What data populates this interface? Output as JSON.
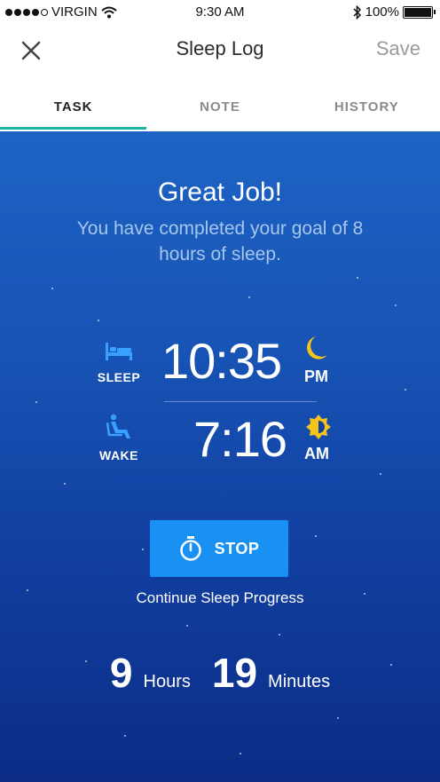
{
  "status_bar": {
    "carrier": "VIRGIN",
    "time": "9:30 AM",
    "battery": "100%"
  },
  "header": {
    "title": "Sleep Log",
    "save_label": "Save",
    "close_icon": "close-icon"
  },
  "tabs": [
    {
      "label": "TASK",
      "active": true
    },
    {
      "label": "NOTE",
      "active": false
    },
    {
      "label": "HISTORY",
      "active": false
    }
  ],
  "summary": {
    "headline": "Great Job!",
    "goal_message": "You have completed your goal of 8 hours of sleep."
  },
  "sleep": {
    "label": "SLEEP",
    "time": "10:35",
    "period": "PM",
    "icon": "bed-icon",
    "period_icon": "moon-icon"
  },
  "wake": {
    "label": "WAKE",
    "time": "7:16",
    "period": "AM",
    "icon": "seated-person-icon",
    "period_icon": "sun-icon"
  },
  "stop_button": {
    "label": "STOP",
    "icon": "stopwatch-icon",
    "caption": "Continue Sleep Progress"
  },
  "duration": {
    "hours_value": "9",
    "hours_unit": "Hours",
    "minutes_value": "19",
    "minutes_unit": "Minutes"
  },
  "colors": {
    "accent_tab": "#1bb3a6",
    "button_blue": "#1890f4",
    "sky_top": "#1d63c4",
    "sky_bottom": "#0c2c86",
    "moon_sun": "#f6c419"
  }
}
